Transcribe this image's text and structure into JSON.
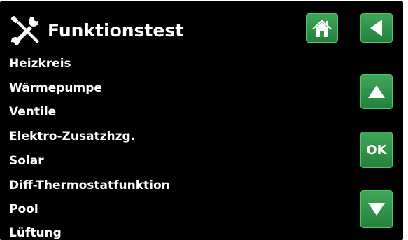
{
  "header": {
    "title": "Funktionstest",
    "icon": "tools-icon"
  },
  "menu": {
    "items": [
      "Heizkreis",
      "Wärmepumpe",
      "Ventile",
      "Elektro-Zusatzhzg.",
      "Solar",
      "Diff-Thermostatfunktion",
      "Pool",
      "Lüftung"
    ]
  },
  "buttons": {
    "home_icon": "home-icon",
    "back_icon": "back-arrow-icon",
    "up_icon": "arrow-up-icon",
    "ok_label": "OK",
    "down_icon": "arrow-down-icon"
  },
  "colors": {
    "background": "#000000",
    "text": "#ffffff",
    "button_green": "#2e9447",
    "button_border": "#4fc56b"
  }
}
